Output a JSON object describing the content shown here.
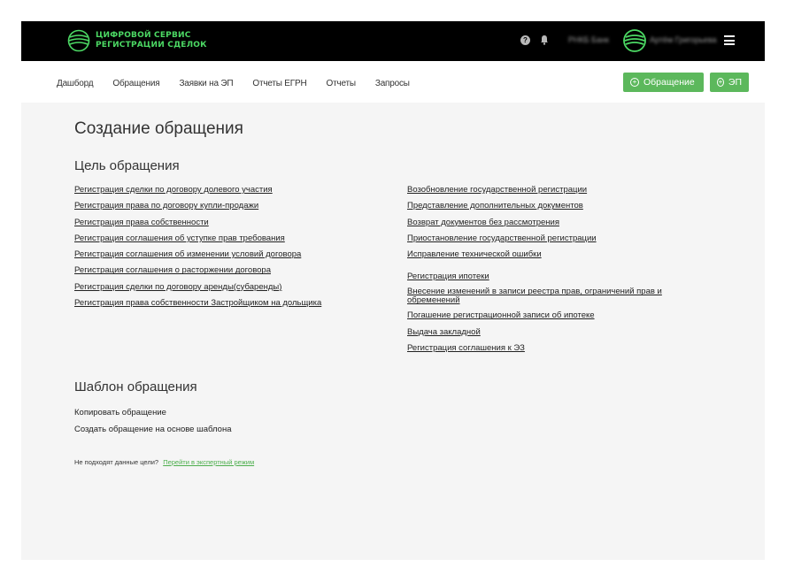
{
  "brand": {
    "line1": "ЦИФРОВОЙ СЕРВИС",
    "line2": "РЕГИСТРАЦИИ СДЕЛОК",
    "accent_color": "#4cd964"
  },
  "topbar": {
    "help_icon": "question-circle-icon",
    "help_glyph": "?",
    "bell_icon": "bell-icon",
    "bank_name": "РНКБ Банк",
    "user_name": "Артём Григорьева",
    "menu_icon": "hamburger-menu-icon"
  },
  "nav": {
    "items": [
      "Дашборд",
      "Обращения",
      "Заявки на ЭП",
      "Отчеты ЕГРН",
      "Отчеты",
      "Запросы"
    ],
    "btn_appeal": "Обращение",
    "btn_ep": "ЭП",
    "button_color": "#5cb85c"
  },
  "page": {
    "title": "Создание обращения",
    "goal_heading": "Цель обращения",
    "left_links": [
      "Регистрация сделки по договору долевого участия",
      "Регистрация права по договору купли-продажи",
      "Регистрация права собственности",
      "Регистрация соглашения об уступке прав требования",
      "Регистрация соглашения об изменении условий договора",
      "Регистрация соглашения о расторжении договора",
      "Регистрация сделки по договору аренды(субаренды)",
      "Регистрация права собственности Застройщиком на дольщика"
    ],
    "right_links_a": [
      "Возобновление государственной регистрации",
      "Представление дополнительных документов",
      "Возврат документов без рассмотрения",
      "Приостановление государственной регистрации",
      "Исправление технической ошибки"
    ],
    "right_links_b": [
      "Регистрация ипотеки",
      "Внесение изменений в записи реестра прав, ограничений прав и обременений",
      "Погашение регистрационной записи об ипотеке",
      "Выдача закладной",
      "Регистрация соглашения к ЭЗ"
    ],
    "template_heading": "Шаблон обращения",
    "template_links": [
      "Копировать обращение",
      "Создать обращение на основе шаблона"
    ],
    "expert_question": "Не подходят данные цели?",
    "expert_link": "Перейти в экспертный режим"
  }
}
